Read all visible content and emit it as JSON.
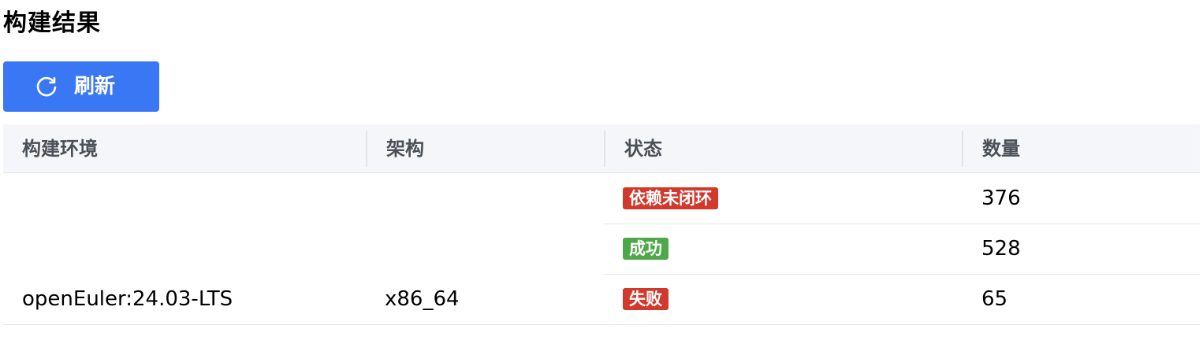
{
  "page": {
    "title": "构建结果"
  },
  "toolbar": {
    "refresh_label": "刷新",
    "refresh_icon": "refresh-icon",
    "accent": "#3a77f5"
  },
  "table": {
    "columns": [
      "构建环境",
      "架构",
      "状态",
      "数量"
    ],
    "rows": [
      {
        "environment": "openEuler:24.03-LTS",
        "arch": "x86_64",
        "statuses": [
          {
            "label": "依赖未闭环",
            "color": "#d0392b",
            "count": "376"
          },
          {
            "label": "成功",
            "color": "#4ea84a",
            "count": "528"
          },
          {
            "label": "失败",
            "color": "#d0392b",
            "count": "65"
          }
        ]
      }
    ]
  }
}
